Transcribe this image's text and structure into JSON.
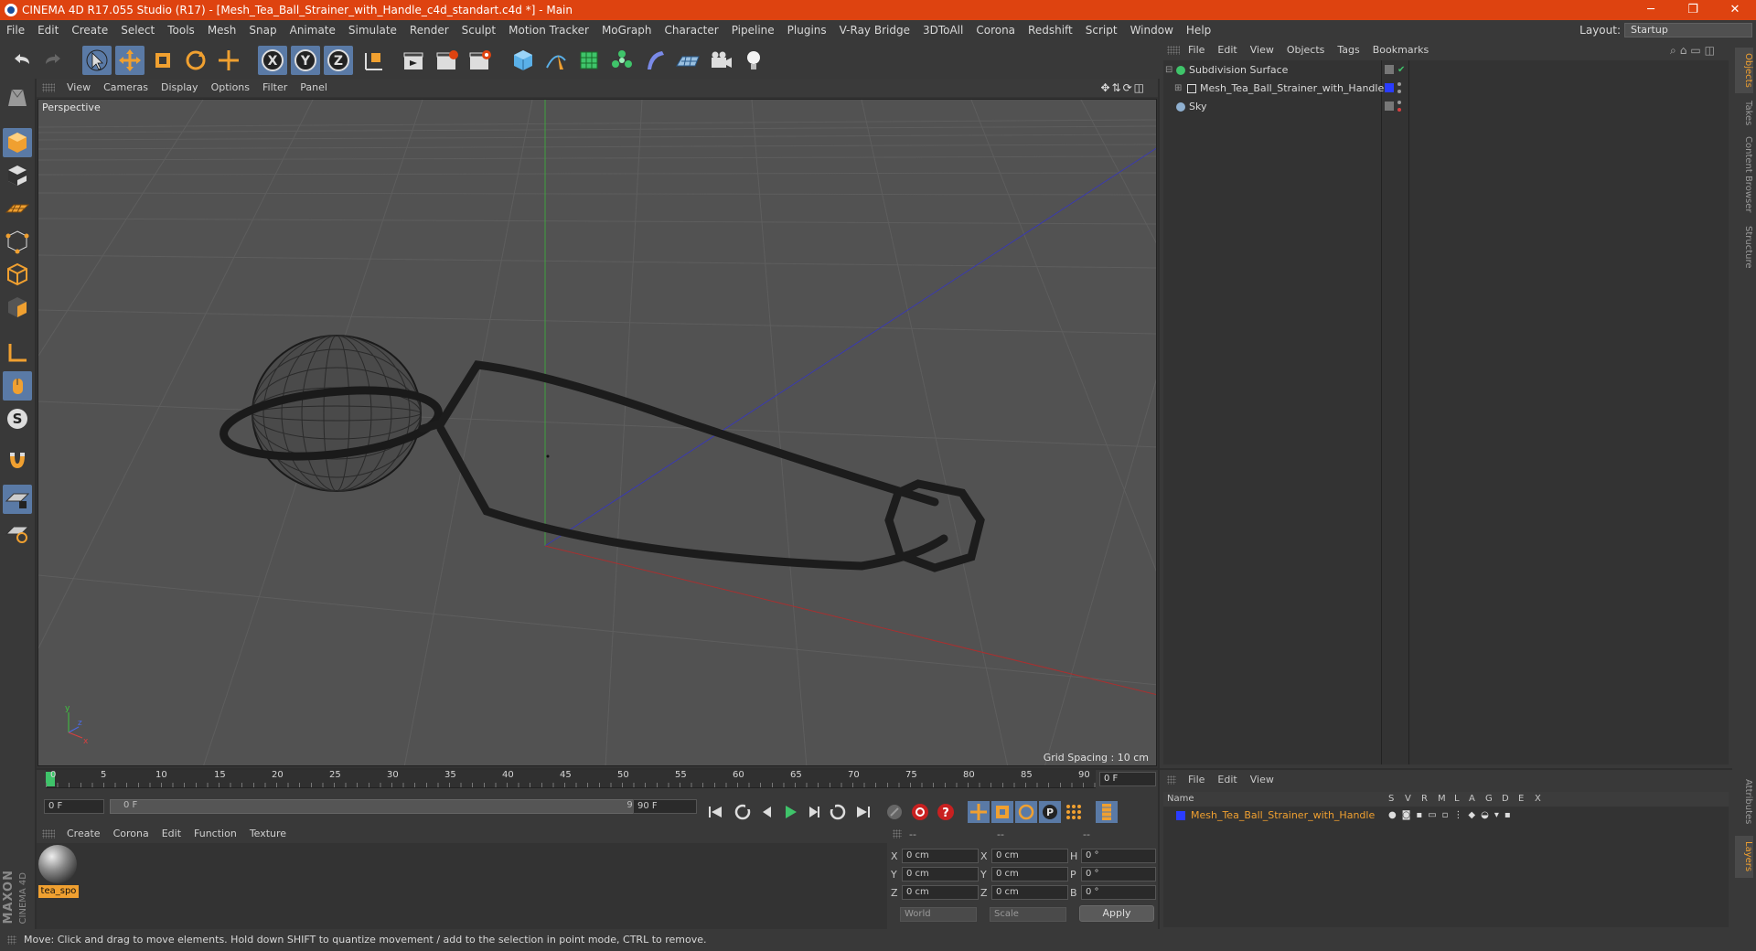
{
  "window": {
    "title": "CINEMA 4D R17.055 Studio (R17) - [Mesh_Tea_Ball_Strainer_with_Handle_c4d_standart.c4d *] - Main",
    "minimize": "─",
    "restore": "❐",
    "close": "✕"
  },
  "menubar": {
    "items": [
      "File",
      "Edit",
      "Create",
      "Select",
      "Tools",
      "Mesh",
      "Snap",
      "Animate",
      "Simulate",
      "Render",
      "Sculpt",
      "Motion Tracker",
      "MoGraph",
      "Character",
      "Pipeline",
      "Plugins",
      "V-Ray Bridge",
      "3DToAll",
      "Corona",
      "Redshift",
      "Script",
      "Window",
      "Help"
    ],
    "layout_label": "Layout:",
    "layout_value": "Startup"
  },
  "viewport": {
    "menu": [
      "View",
      "Cameras",
      "Display",
      "Options",
      "Filter",
      "Panel"
    ],
    "label": "Perspective",
    "grid_spacing": "Grid Spacing : 10 cm",
    "axis_y": "y",
    "axis_z": "z",
    "axis_x": "x"
  },
  "timeline": {
    "ticks": [
      "0",
      "5",
      "10",
      "15",
      "20",
      "25",
      "30",
      "35",
      "40",
      "45",
      "50",
      "55",
      "60",
      "65",
      "70",
      "75",
      "80",
      "85",
      "90"
    ],
    "current_frame": "0 F",
    "start_field": "0 F",
    "range_start": "0 F",
    "range_end": "90 F",
    "end_field": "90 F"
  },
  "material_manager": {
    "menu": [
      "Create",
      "Corona",
      "Edit",
      "Function",
      "Texture"
    ],
    "material_name": "tea_spo"
  },
  "coordinates": {
    "headers": [
      "--",
      "--",
      "--"
    ],
    "rows": [
      {
        "a": "X",
        "av": "0 cm",
        "b": "X",
        "bv": "0 cm",
        "c": "H",
        "cv": "0 °"
      },
      {
        "a": "Y",
        "av": "0 cm",
        "b": "Y",
        "bv": "0 cm",
        "c": "P",
        "cv": "0 °"
      },
      {
        "a": "Z",
        "av": "0 cm",
        "b": "Z",
        "bv": "0 cm",
        "c": "B",
        "cv": "0 °"
      }
    ],
    "mode1": "World",
    "mode2": "Scale",
    "apply": "Apply"
  },
  "object_manager": {
    "menu": [
      "File",
      "Edit",
      "View",
      "Objects",
      "Tags",
      "Bookmarks"
    ],
    "objects": [
      {
        "name": "Subdivision Surface",
        "color": "#3fc46a"
      },
      {
        "name": "Mesh_Tea_Ball_Strainer_with_Handle",
        "color": "#a0a0ff"
      },
      {
        "name": "Sky",
        "color": "#8fb0d0"
      }
    ]
  },
  "layers": {
    "menu": [
      "File",
      "Edit",
      "View"
    ],
    "columns": [
      "Name",
      "S",
      "V",
      "R",
      "M",
      "L",
      "A",
      "G",
      "D",
      "E",
      "X"
    ],
    "layer_name": "Mesh_Tea_Ball_Strainer_with_Handle",
    "layer_color": "#2a3cff"
  },
  "right_tabs": [
    "Objects",
    "Takes",
    "Content Browser",
    "Structure"
  ],
  "right_tabs_lower": [
    "Attributes",
    "Layers"
  ],
  "maxon_logo": "MAXON",
  "maxon_sub": "CINEMA 4D",
  "status": "Move: Click and drag to move elements. Hold down SHIFT to quantize movement / add to the selection in point mode, CTRL to remove.",
  "colors": {
    "accent": "#de4310",
    "selected": "#5a7aa6",
    "active_name": "#f0a030"
  }
}
